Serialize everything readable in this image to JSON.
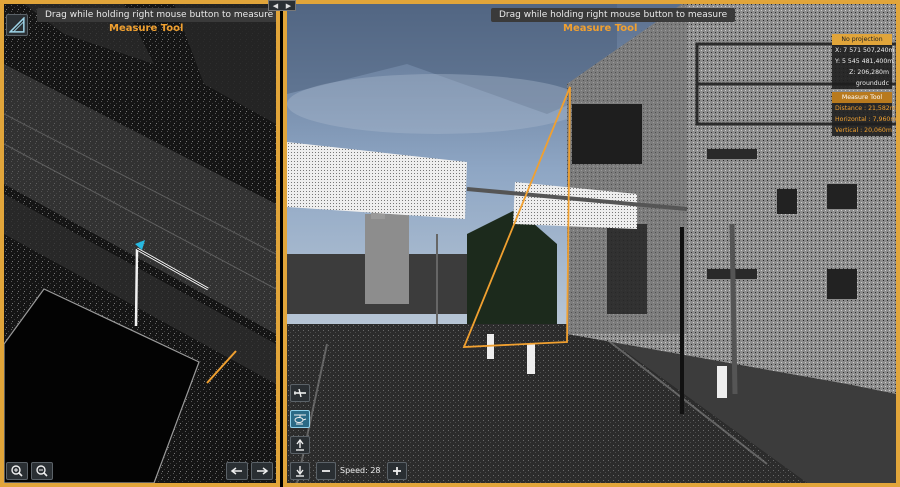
{
  "left": {
    "hint": "Drag while holding right mouse button to measure",
    "tool_title": "Measure Tool"
  },
  "right": {
    "hint": "Drag while holding right mouse button to measure",
    "tool_title": "Measure Tool"
  },
  "info": {
    "projection": "No projection",
    "x": "X:  7 571 507,240m",
    "y": "Y:  5 545 481,400m",
    "z": "Z:      206,280m",
    "class": "groundudc",
    "measure_title": "Measure Tool",
    "distance": "Distance  :  21,582m",
    "horizontal": "Horizontal  :  7,960m",
    "vertical": "Vertical  :  20,060m"
  },
  "speed": {
    "label": "Speed:",
    "value": "28"
  },
  "colors": {
    "accent": "#e1a53a",
    "active_button": "#2a6a86"
  },
  "icons": {
    "view_mode": "perspective-icon",
    "zoom_in": "zoom-in-icon",
    "zoom_out": "zoom-out-icon",
    "undo": "undo-arrow-icon",
    "redo": "redo-arrow-icon",
    "airplane": "airplane-icon",
    "helicopter": "helicopter-icon",
    "ascend": "ascend-icon",
    "descend": "descend-icon",
    "speed_down": "minus-icon",
    "speed_up": "plus-icon"
  }
}
